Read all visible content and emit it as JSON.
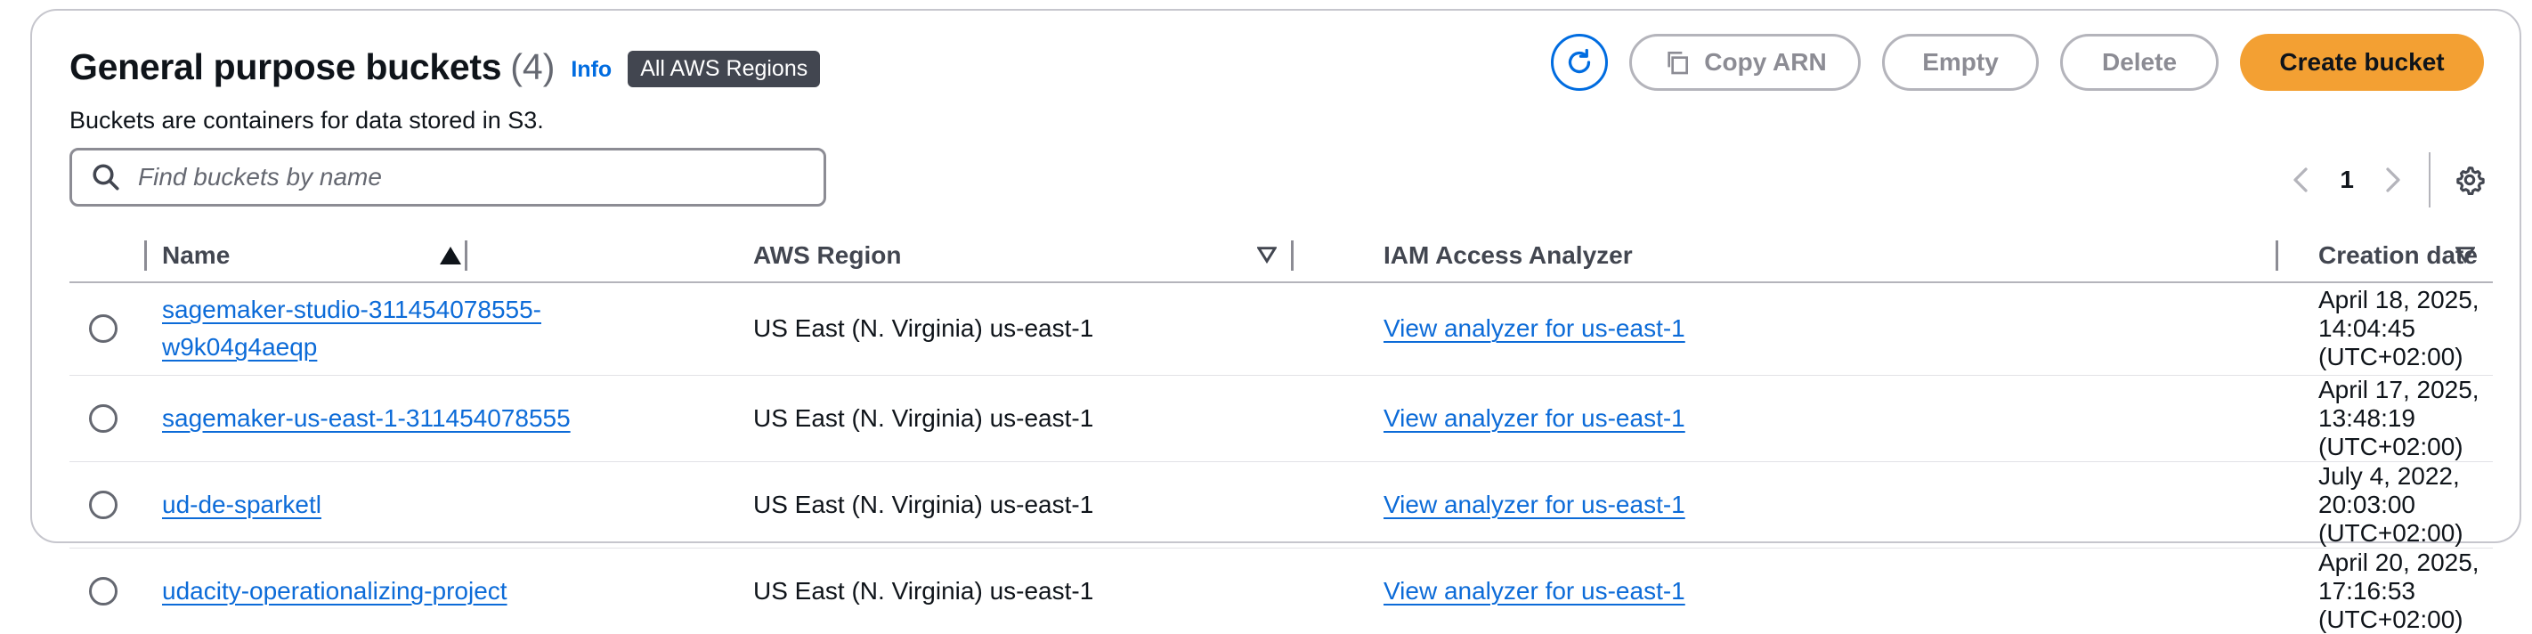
{
  "header": {
    "title": "General purpose buckets",
    "count": "(4)",
    "info": "Info",
    "region_badge": "All AWS Regions",
    "description": "Buckets are containers for data stored in S3."
  },
  "actions": {
    "copy_arn": "Copy ARN",
    "empty": "Empty",
    "delete": "Delete",
    "create": "Create bucket"
  },
  "search": {
    "placeholder": "Find buckets by name",
    "value": ""
  },
  "pagination": {
    "current_page": "1"
  },
  "table": {
    "columns": [
      "Name",
      "AWS Region",
      "IAM Access Analyzer",
      "Creation date"
    ],
    "rows": [
      {
        "name": "sagemaker-studio-311454078555-w9k04g4aeqp",
        "region": "US East (N. Virginia) us-east-1",
        "analyzer": "View analyzer for us-east-1",
        "created": "April 18, 2025, 14:04:45 (UTC+02:00)"
      },
      {
        "name": "sagemaker-us-east-1-311454078555",
        "region": "US East (N. Virginia) us-east-1",
        "analyzer": "View analyzer for us-east-1",
        "created": "April 17, 2025, 13:48:19 (UTC+02:00)"
      },
      {
        "name": "ud-de-sparketl",
        "region": "US East (N. Virginia) us-east-1",
        "analyzer": "View analyzer for us-east-1",
        "created": "July 4, 2022, 20:03:00 (UTC+02:00)"
      },
      {
        "name": "udacity-operationalizing-project",
        "region": "US East (N. Virginia) us-east-1",
        "analyzer": "View analyzer for us-east-1",
        "created": "April 20, 2025, 17:16:53 (UTC+02:00)"
      }
    ]
  },
  "colors": {
    "primary": "#f3a033",
    "link": "#0c6bd8",
    "badge": "#424650"
  }
}
